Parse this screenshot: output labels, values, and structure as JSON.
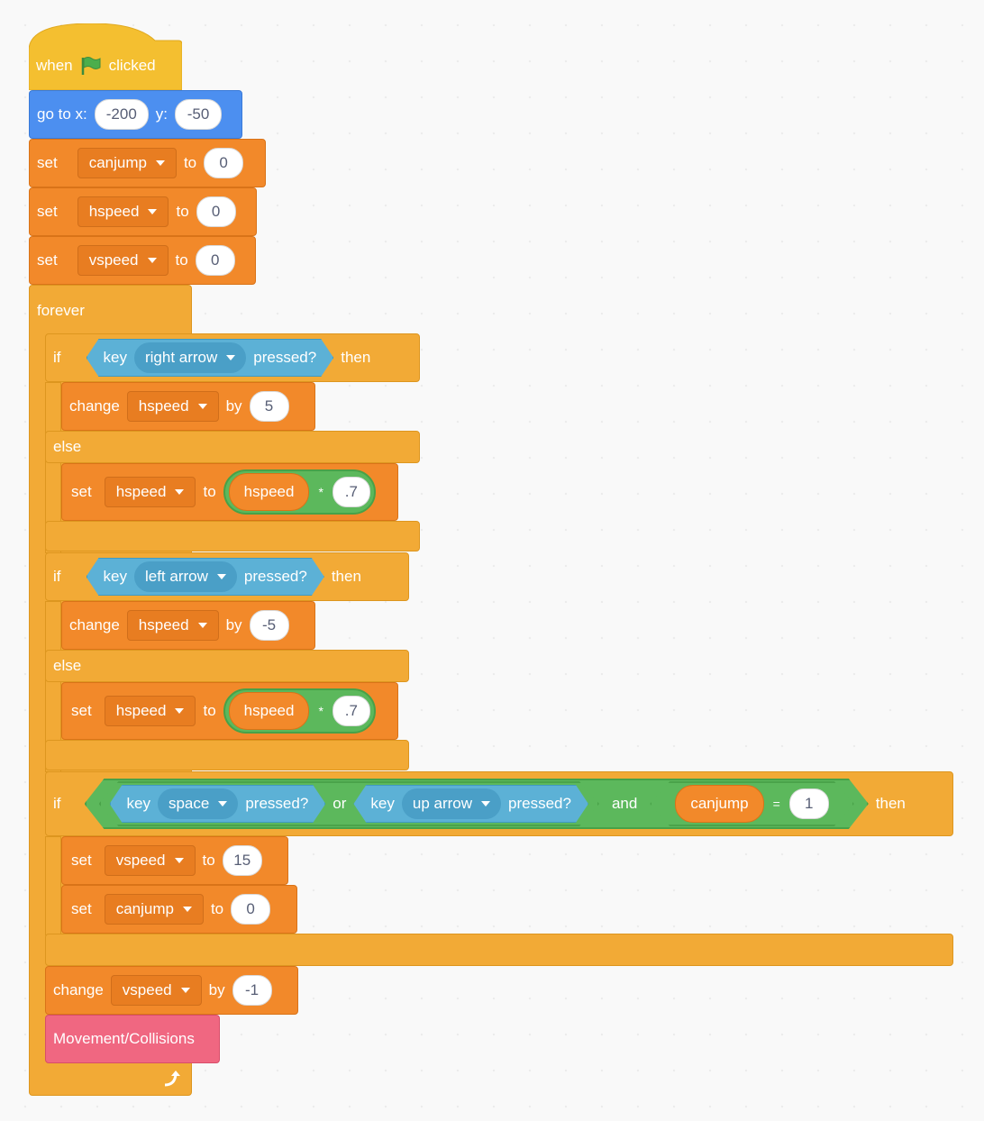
{
  "script": {
    "hat": {
      "when": "when",
      "flag_icon": "green-flag",
      "clicked": "clicked"
    },
    "goto": {
      "label": "go to x:",
      "x": "-200",
      "y_label": "y:",
      "y": "-50"
    },
    "init": [
      {
        "verb": "set",
        "var": "canjump",
        "to": "to",
        "value": "0"
      },
      {
        "verb": "set",
        "var": "hspeed",
        "to": "to",
        "value": "0"
      },
      {
        "verb": "set",
        "var": "vspeed",
        "to": "to",
        "value": "0"
      }
    ],
    "forever": {
      "label": "forever",
      "loop_icon": "loop-arrow"
    },
    "if_right": {
      "if": "if",
      "key": "key",
      "key_name": "right arrow",
      "pressed": "pressed?",
      "then": "then",
      "change": {
        "verb": "change",
        "var": "hspeed",
        "by": "by",
        "value": "5"
      },
      "else": "else",
      "set": {
        "verb": "set",
        "var": "hspeed",
        "to": "to",
        "reporter": "hspeed",
        "op": "*",
        "value": ".7"
      }
    },
    "if_left": {
      "if": "if",
      "key": "key",
      "key_name": "left arrow",
      "pressed": "pressed?",
      "then": "then",
      "change": {
        "verb": "change",
        "var": "hspeed",
        "by": "by",
        "value": "-5"
      },
      "else": "else",
      "set": {
        "verb": "set",
        "var": "hspeed",
        "to": "to",
        "reporter": "hspeed",
        "op": "*",
        "value": ".7"
      }
    },
    "if_jump": {
      "if": "if",
      "cond1": {
        "key": "key",
        "key_name": "space",
        "pressed": "pressed?"
      },
      "or": "or",
      "cond2": {
        "key": "key",
        "key_name": "up arrow",
        "pressed": "pressed?"
      },
      "and": "and",
      "cond3": {
        "reporter": "canjump",
        "op": "=",
        "value": "1"
      },
      "then": "then",
      "set1": {
        "verb": "set",
        "var": "vspeed",
        "to": "to",
        "value": "15"
      },
      "set2": {
        "verb": "set",
        "var": "canjump",
        "to": "to",
        "value": "0"
      }
    },
    "change_v": {
      "verb": "change",
      "var": "vspeed",
      "by": "by",
      "value": "-1"
    },
    "custom": {
      "label": "Movement/Collisions"
    }
  }
}
